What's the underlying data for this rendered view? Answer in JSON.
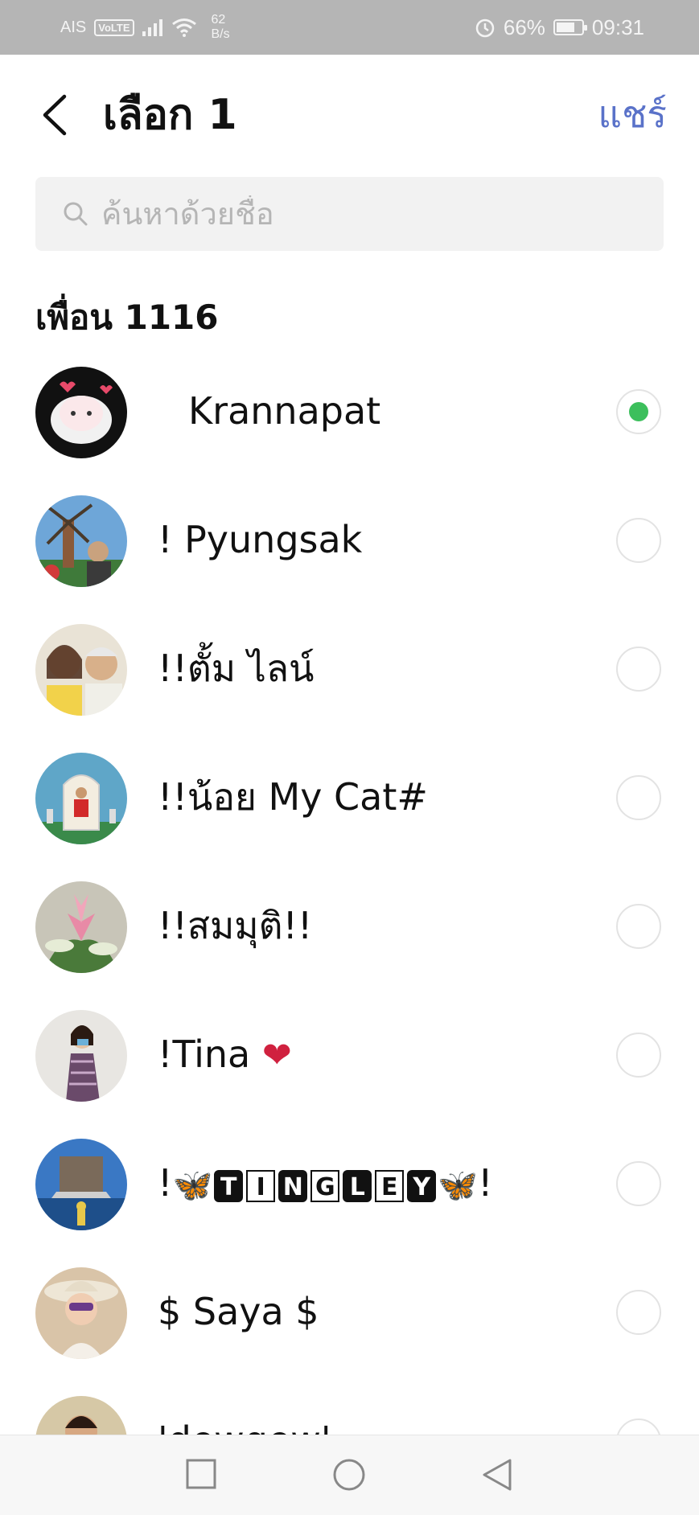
{
  "status_bar": {
    "carrier": "AIS",
    "volte": "VoLTE",
    "net_speed_value": "62",
    "net_speed_unit": "B/s",
    "battery": "66%",
    "battery_level": 0.66,
    "time": "09:31"
  },
  "header": {
    "title": "เลือก 1",
    "share_label": "แชร์"
  },
  "search": {
    "placeholder": "ค้นหาด้วยชื่อ",
    "value": ""
  },
  "section": {
    "title": "เพื่อน 1116"
  },
  "contacts": [
    {
      "name": "Krannapat",
      "selected": true
    },
    {
      "name": "! Pyungsak",
      "selected": false
    },
    {
      "name": "!!ตั้ม ไลน์",
      "selected": false
    },
    {
      "name": "!!น้อย My Cat#",
      "selected": false
    },
    {
      "name": "!!สมมุติ!!",
      "selected": false
    },
    {
      "name": "!Tina",
      "name_emoji": "❤",
      "selected": false
    },
    {
      "name_prefix": "!",
      "name_letters": [
        "T",
        "I",
        "N",
        "G",
        "L",
        "E",
        "Y"
      ],
      "name_suffix": "!",
      "selected": false
    },
    {
      "name": "$ Saya $",
      "selected": false
    },
    {
      "name": "'dewgew'",
      "selected": false
    }
  ],
  "colors": {
    "accent": "#5a72c9",
    "selected": "#3cbf5c",
    "status_bar": "#b5b5b5"
  },
  "icons": {
    "back": "chevron-left-icon",
    "search": "search-icon",
    "nav": [
      "recents-square-icon",
      "home-circle-icon",
      "back-triangle-icon"
    ]
  }
}
